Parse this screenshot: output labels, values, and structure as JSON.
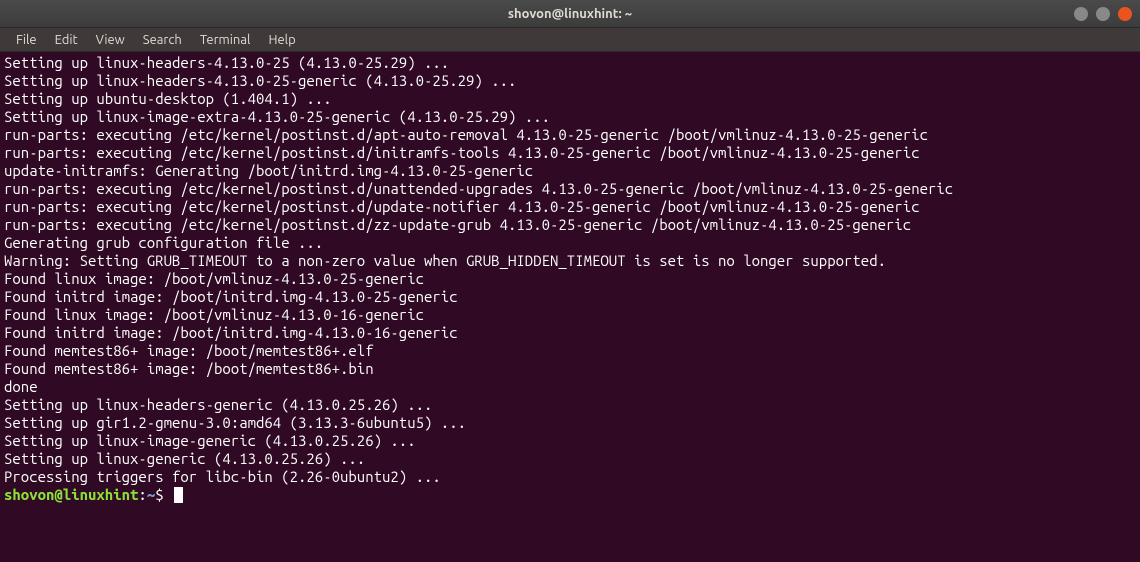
{
  "titlebar": {
    "title": "shovon@linuxhint: ~"
  },
  "menubar": {
    "items": [
      "File",
      "Edit",
      "View",
      "Search",
      "Terminal",
      "Help"
    ]
  },
  "terminal": {
    "lines": [
      "Setting up linux-headers-4.13.0-25 (4.13.0-25.29) ...",
      "Setting up linux-headers-4.13.0-25-generic (4.13.0-25.29) ...",
      "Setting up ubuntu-desktop (1.404.1) ...",
      "Setting up linux-image-extra-4.13.0-25-generic (4.13.0-25.29) ...",
      "run-parts: executing /etc/kernel/postinst.d/apt-auto-removal 4.13.0-25-generic /boot/vmlinuz-4.13.0-25-generic",
      "run-parts: executing /etc/kernel/postinst.d/initramfs-tools 4.13.0-25-generic /boot/vmlinuz-4.13.0-25-generic",
      "update-initramfs: Generating /boot/initrd.img-4.13.0-25-generic",
      "run-parts: executing /etc/kernel/postinst.d/unattended-upgrades 4.13.0-25-generic /boot/vmlinuz-4.13.0-25-generic",
      "run-parts: executing /etc/kernel/postinst.d/update-notifier 4.13.0-25-generic /boot/vmlinuz-4.13.0-25-generic",
      "run-parts: executing /etc/kernel/postinst.d/zz-update-grub 4.13.0-25-generic /boot/vmlinuz-4.13.0-25-generic",
      "Generating grub configuration file ...",
      "Warning: Setting GRUB_TIMEOUT to a non-zero value when GRUB_HIDDEN_TIMEOUT is set is no longer supported.",
      "Found linux image: /boot/vmlinuz-4.13.0-25-generic",
      "Found initrd image: /boot/initrd.img-4.13.0-25-generic",
      "Found linux image: /boot/vmlinuz-4.13.0-16-generic",
      "Found initrd image: /boot/initrd.img-4.13.0-16-generic",
      "Found memtest86+ image: /boot/memtest86+.elf",
      "Found memtest86+ image: /boot/memtest86+.bin",
      "done",
      "Setting up linux-headers-generic (4.13.0.25.26) ...",
      "Setting up gir1.2-gmenu-3.0:amd64 (3.13.3-6ubuntu5) ...",
      "Setting up linux-image-generic (4.13.0.25.26) ...",
      "Setting up linux-generic (4.13.0.25.26) ...",
      "Processing triggers for libc-bin (2.26-0ubuntu2) ..."
    ],
    "prompt": {
      "user_host": "shovon@linuxhint",
      "sep": ":",
      "path": "~",
      "dollar": "$ "
    }
  }
}
